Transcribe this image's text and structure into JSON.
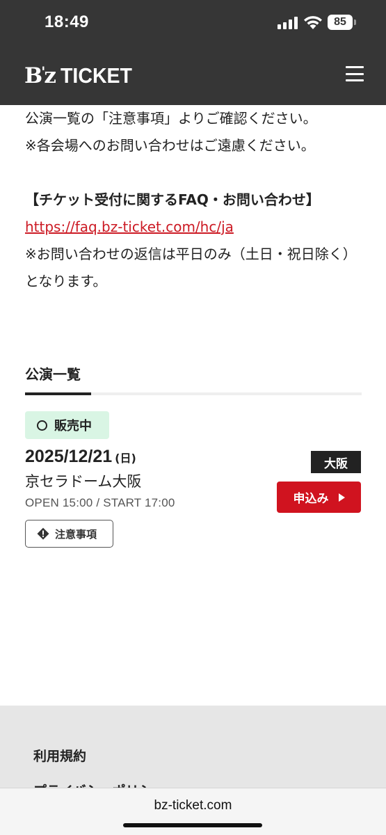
{
  "status_bar": {
    "time": "18:49",
    "battery": "85"
  },
  "header": {
    "logo_bz": "B",
    "logo_apos": "'",
    "logo_z": "z",
    "logo_ticket": "TICKET",
    "menu_icon": "hamburger-icon"
  },
  "content": {
    "line1": "公演一覧の「注意事項」よりご確認ください。",
    "line2": "※各会場へのお問い合わせはご遠慮ください。",
    "faq_heading": "【チケット受付に関するFAQ・お問い合わせ】",
    "faq_link": "https://faq.bz-ticket.com/hc/ja",
    "faq_note": "※お問い合わせの返信は平日のみ（土日・祝日除く）となります。"
  },
  "performances": {
    "section_title": "公演一覧",
    "items": [
      {
        "status": "販売中",
        "date": "2025/12/21",
        "day_of_week": "(日)",
        "venue": "京セラドーム大阪",
        "times": "OPEN 15:00 / START 17:00",
        "caution_label": "注意事項",
        "region": "大阪",
        "apply_label": "申込み"
      }
    ]
  },
  "footer": {
    "terms": "利用規約",
    "privacy": "プライバシーポリシー"
  },
  "browser": {
    "url": "bz-ticket.com"
  },
  "colors": {
    "header_bg": "#363636",
    "link": "#cc1a24",
    "apply_button": "#d0131f",
    "status_badge_bg": "#d9f5e4"
  }
}
